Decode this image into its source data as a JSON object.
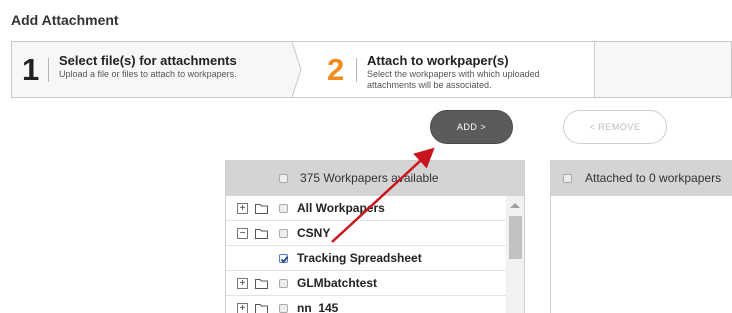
{
  "page": {
    "title": "Add Attachment"
  },
  "wizard": {
    "step1": {
      "number": "1",
      "title": "Select file(s) for attachments",
      "desc": "Upload a file or files to attach to workpapers."
    },
    "step2": {
      "number": "2",
      "title": "Attach to workpaper(s)",
      "desc": "Select the workpapers with which uploaded attachments will be associated."
    }
  },
  "actions": {
    "add_label": "ADD >",
    "remove_label": "< REMOVE"
  },
  "available": {
    "header": "375 Workpapers available",
    "rows": [
      {
        "label": "All Workpapers",
        "expander": "+",
        "folder": true,
        "checked": false
      },
      {
        "label": "CSNY",
        "expander": "−",
        "folder": true,
        "checked": false
      },
      {
        "label": "Tracking Spreadsheet",
        "expander": "",
        "folder": false,
        "checked": true
      },
      {
        "label": "GLMbatchtest",
        "expander": "+",
        "folder": true,
        "checked": false
      },
      {
        "label": "nn_145",
        "expander": "+",
        "folder": true,
        "checked": false
      }
    ]
  },
  "attached": {
    "header": "Attached to 0 workpapers"
  },
  "colors": {
    "accent": "#f28a1c",
    "annotation": "#c8141e",
    "add_button": "#5b5b5b"
  }
}
